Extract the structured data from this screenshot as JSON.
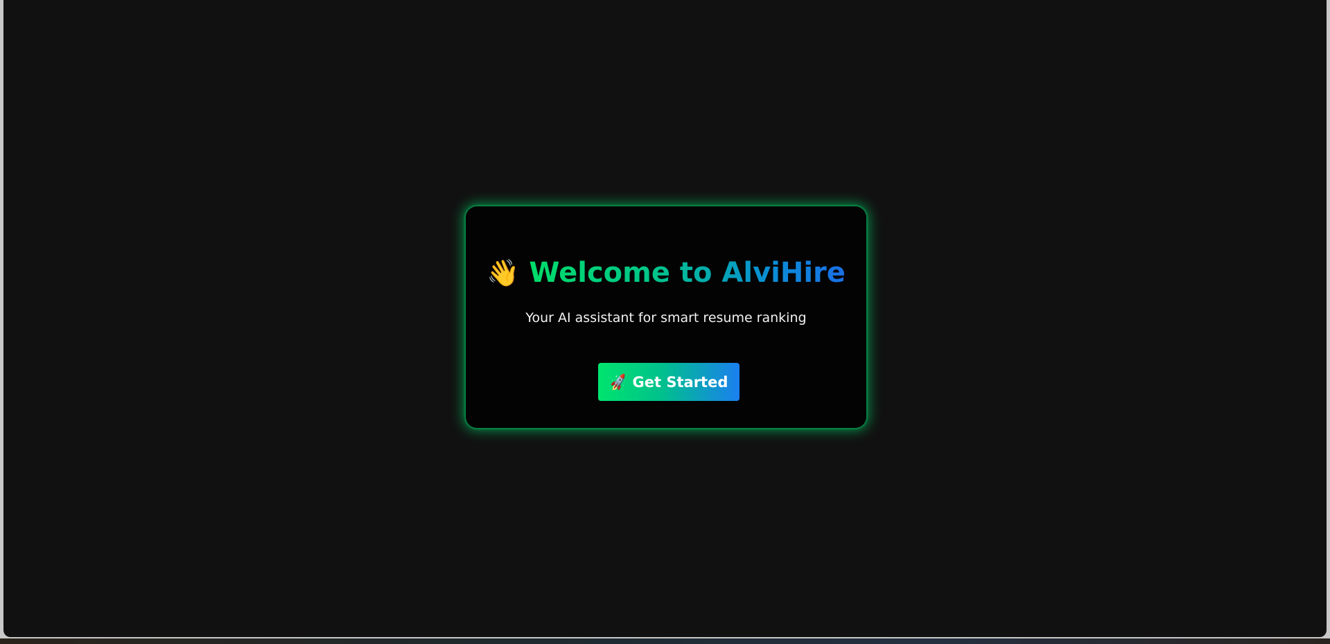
{
  "welcome_card": {
    "title_icon": "waving-hand-icon",
    "title_icon_glyph": "👋",
    "title": "Welcome to AlviHire",
    "subtitle": "Your AI assistant for smart resume ranking",
    "cta": {
      "icon": "rocket-icon",
      "icon_glyph": "🚀",
      "label": "Get Started"
    }
  },
  "colors": {
    "page_background": "#111111",
    "card_background": "#030303",
    "glow": "#00c864",
    "gradient_start": "#00dd6a",
    "gradient_end": "#1a6fe6",
    "subtitle_text": "#f2f2f2"
  }
}
